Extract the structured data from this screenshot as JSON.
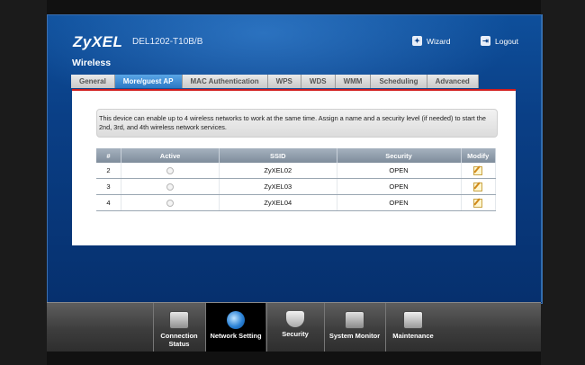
{
  "header": {
    "brand": "ZyXEL",
    "model": "DEL1202-T10B/B",
    "wizard_label": "Wizard",
    "logout_label": "Logout"
  },
  "page_title": "Wireless",
  "tabs": [
    {
      "label": "General",
      "active": false
    },
    {
      "label": "More/guest AP",
      "active": true
    },
    {
      "label": "MAC Authentication",
      "active": false
    },
    {
      "label": "WPS",
      "active": false
    },
    {
      "label": "WDS",
      "active": false
    },
    {
      "label": "WMM",
      "active": false
    },
    {
      "label": "Scheduling",
      "active": false
    },
    {
      "label": "Advanced",
      "active": false
    }
  ],
  "info": {
    "line1": "This device can enable up to 4 wireless networks to work at the same time. Assign a name and a security level (if needed) to start the",
    "line2": "2nd, 3rd, and 4th wireless network services."
  },
  "table": {
    "headers": [
      "#",
      "Active",
      "SSID",
      "Security",
      "Modify"
    ],
    "rows": [
      {
        "num": "2",
        "ssid": "ZyXEL02",
        "security": "OPEN"
      },
      {
        "num": "3",
        "ssid": "ZyXEL03",
        "security": "OPEN"
      },
      {
        "num": "4",
        "ssid": "ZyXEL04",
        "security": "OPEN"
      }
    ]
  },
  "dock": [
    {
      "label": "Connection Status",
      "icon": "connection-status-icon"
    },
    {
      "label": "Network Setting",
      "icon": "network-setting-icon",
      "active": true
    },
    {
      "label": "Security",
      "icon": "security-icon"
    },
    {
      "label": "System Monitor",
      "icon": "system-monitor-icon"
    },
    {
      "label": "Maintenance",
      "icon": "maintenance-icon"
    }
  ],
  "colors": {
    "accent_blue": "#0a3f86",
    "active_tab": "#2b78c4",
    "panel_border": "#d21c1c"
  }
}
